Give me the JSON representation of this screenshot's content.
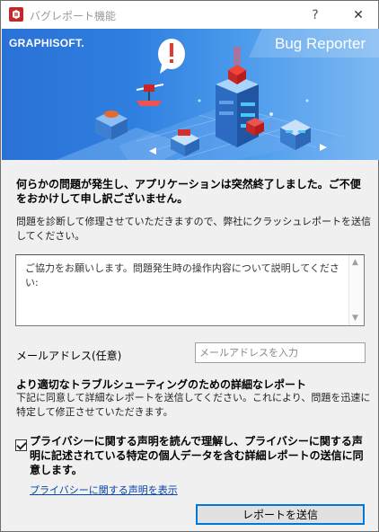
{
  "window": {
    "title": "バグレポート機能",
    "help_label": "?",
    "close_label": "✕"
  },
  "banner": {
    "brand": "GRAPHISOFT.",
    "product": "Bug Reporter",
    "alert_glyph": "!",
    "colors": {
      "accent": "#2f7fe0",
      "alert": "#e53935"
    }
  },
  "message": {
    "heading": "何らかの問題が発生し、アプリケーションは突然終了しました。ご不便をおかけして申し訳ございません。",
    "description": "問題を診断して修理させていただきますので、弊社にクラッシュレポートを送信してください。"
  },
  "comment": {
    "placeholder": "ご協力をお願いします。問題発生時の操作内容について説明してください:"
  },
  "email": {
    "label": "メールアドレス(任意)",
    "placeholder": "メールアドレスを入力"
  },
  "detail": {
    "heading": "より適切なトラブルシューティングのための詳細なレポート",
    "description": "下記に同意して詳細なレポートを送信してください。これにより、問題を迅速に特定して修正させていただきます。"
  },
  "consent": {
    "checked": true,
    "label": "プライバシーに関する声明を読んで理解し、プライバシーに関する声明に記述されている特定の個人データを含む詳細レポートの送信に同意します。"
  },
  "links": {
    "privacy": "プライバシーに関する声明を表示"
  },
  "actions": {
    "submit": "レポートを送信"
  }
}
